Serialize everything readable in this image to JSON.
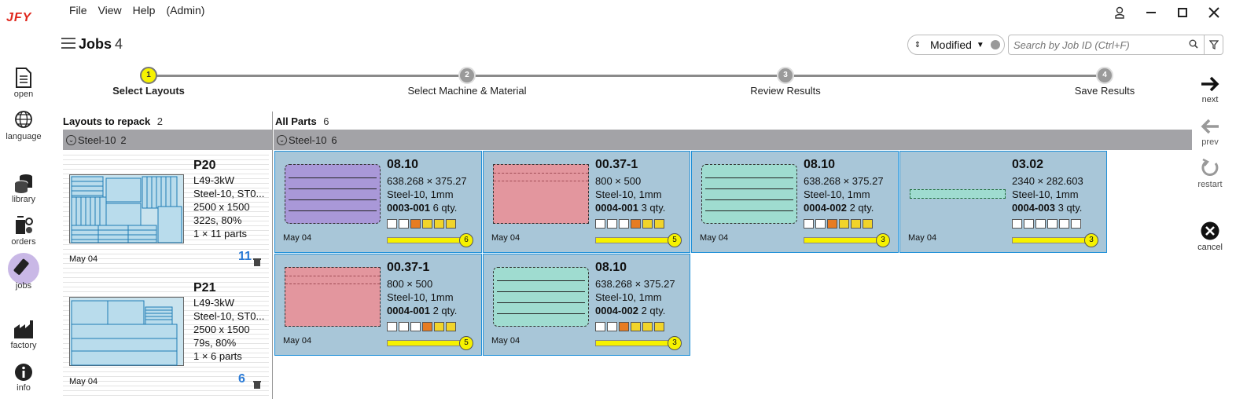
{
  "app": {
    "logo": "JFY"
  },
  "menu": [
    "File",
    "View",
    "Help",
    "(Admin)"
  ],
  "header": {
    "title": "Jobs",
    "count": "4"
  },
  "sort": {
    "value": "Modified"
  },
  "search": {
    "placeholder": "Search by Job ID (Ctrl+F)"
  },
  "rail": [
    {
      "label": "open",
      "icon": "document-icon"
    },
    {
      "label": "language",
      "icon": "globe-icon"
    },
    {
      "label": "library",
      "icon": "database-icon"
    },
    {
      "label": "orders",
      "icon": "orders-icon"
    },
    {
      "label": "jobs",
      "icon": "jobs-icon"
    },
    {
      "label": "factory",
      "icon": "factory-icon"
    },
    {
      "label": "info",
      "icon": "info-icon"
    }
  ],
  "steps": [
    {
      "num": "1",
      "label": "Select Layouts",
      "active": true
    },
    {
      "num": "2",
      "label": "Select Machine & Material",
      "active": false
    },
    {
      "num": "3",
      "label": "Review Results",
      "active": false
    },
    {
      "num": "4",
      "label": "Save Results",
      "active": false
    }
  ],
  "actions": {
    "next": "next",
    "prev": "prev",
    "restart": "restart",
    "cancel": "cancel"
  },
  "layouts": {
    "title": "Layouts to repack",
    "count": "2",
    "group": {
      "name": "Steel-10",
      "count": "2"
    },
    "items": [
      {
        "name": "P20",
        "lines": [
          "L49-3kW",
          "Steel-10, ST0...",
          "2500 x 1500",
          "322s, 80%",
          "1 × 11 parts"
        ],
        "date": "May 04",
        "count": "11"
      },
      {
        "name": "P21",
        "lines": [
          "L49-3kW",
          "Steel-10, ST0...",
          "2500 x 1500",
          "79s, 80%",
          "1 × 6 parts"
        ],
        "date": "May 04",
        "count": "6"
      }
    ]
  },
  "parts": {
    "title": "All Parts",
    "count": "6",
    "group": {
      "name": "Steel-10",
      "count": "6"
    },
    "items": [
      {
        "name": "08.10",
        "dims": "638.268 × 375.27",
        "material": "Steel-10, 1mm",
        "id": "0003-001",
        "qty": "6 qty.",
        "date": "May 04",
        "badge": "6",
        "color": "#a998d8"
      },
      {
        "name": "00.37-1",
        "dims": "800 × 500",
        "material": "Steel-10, 1mm",
        "id": "0004-001",
        "qty": "3 qty.",
        "date": "May 04",
        "badge": "5",
        "color": "#e3969e"
      },
      {
        "name": "08.10",
        "dims": "638.268 × 375.27",
        "material": "Steel-10, 1mm",
        "id": "0004-002",
        "qty": "2 qty.",
        "date": "May 04",
        "badge": "3",
        "color": "#9fdcd0"
      },
      {
        "name": "03.02",
        "dims": "2340 × 282.603",
        "material": "Steel-10, 1mm",
        "id": "0004-003",
        "qty": "3 qty.",
        "date": "May 04",
        "badge": "3",
        "color": "#9fdcd0"
      },
      {
        "name": "00.37-1",
        "dims": "800 × 500",
        "material": "Steel-10, 1mm",
        "id": "0004-001",
        "qty": "2 qty.",
        "date": "May 04",
        "badge": "5",
        "color": "#e3969e"
      },
      {
        "name": "08.10",
        "dims": "638.268 × 375.27",
        "material": "Steel-10, 1mm",
        "id": "0004-002",
        "qty": "2 qty.",
        "date": "May 04",
        "badge": "3",
        "color": "#9fdcd0"
      }
    ]
  }
}
